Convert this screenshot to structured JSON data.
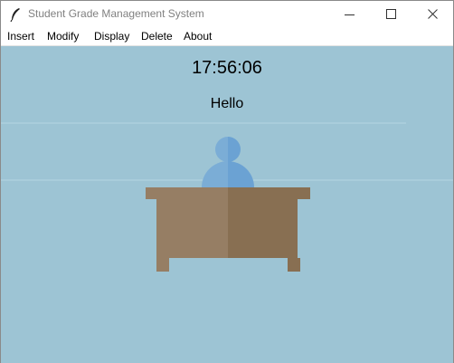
{
  "window": {
    "title": "Student Grade Management System",
    "icon": "feather-icon",
    "controls": [
      "minimize-icon",
      "maximize-icon",
      "close-icon"
    ]
  },
  "menu": {
    "items": [
      "Insert",
      "Modify",
      "Display",
      "Delete",
      "About"
    ]
  },
  "main": {
    "clock": "17:56:06",
    "greeting": "Hello",
    "illustration": "person-at-desk"
  },
  "colors": {
    "canvas_bg": "#9dc4d4",
    "person_light": "#7badd6",
    "person_dark": "#6ba2d3",
    "desk_light": "#967e64",
    "desk_dark": "#886f52"
  }
}
